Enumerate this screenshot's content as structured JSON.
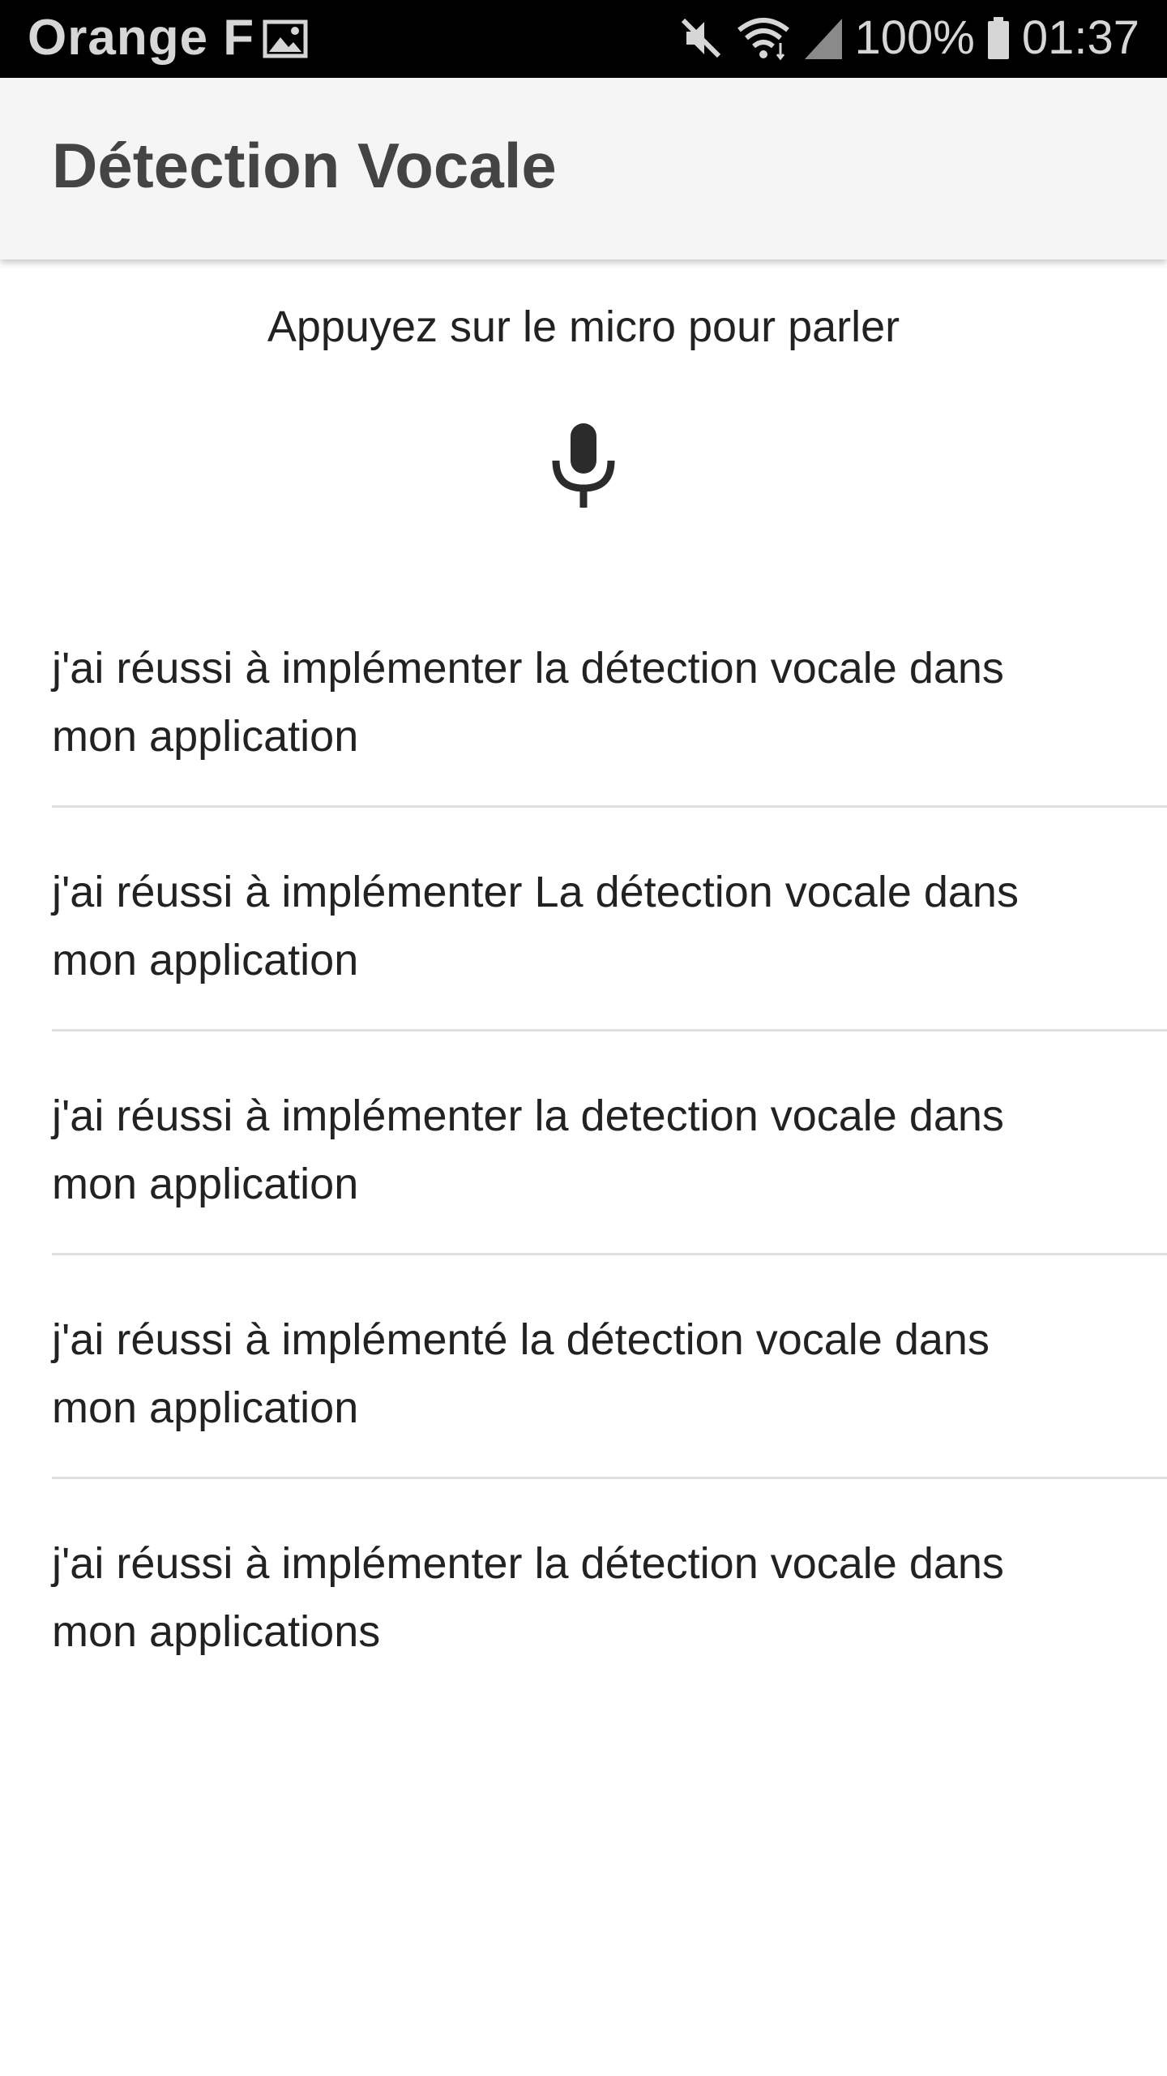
{
  "status_bar": {
    "carrier": "Orange F",
    "battery": "100%",
    "time": "01:37",
    "icons": [
      "image-icon",
      "mute-icon",
      "wifi-icon",
      "signal-icon",
      "battery-icon"
    ]
  },
  "app_bar": {
    "title": "Détection Vocale"
  },
  "main": {
    "prompt": "Appuyez sur le micro pour parler",
    "mic_icon": "microphone-icon",
    "results": [
      {
        "text": "j'ai réussi à implémenter la détection vocale dans mon application"
      },
      {
        "text": "j'ai réussi à implémenter La détection vocale dans mon application"
      },
      {
        "text": "j'ai réussi à implémenter la detection vocale dans mon application"
      },
      {
        "text": "j'ai réussi à implémenté la détection vocale dans mon application"
      },
      {
        "text": "j'ai réussi à implémenter la détection vocale dans mon applications"
      }
    ]
  },
  "colors": {
    "status_bar_bg": "#000000",
    "app_bar_bg": "#f5f5f5",
    "title_text": "#444444",
    "body_text": "#222222",
    "divider": "#e0e0e0"
  }
}
